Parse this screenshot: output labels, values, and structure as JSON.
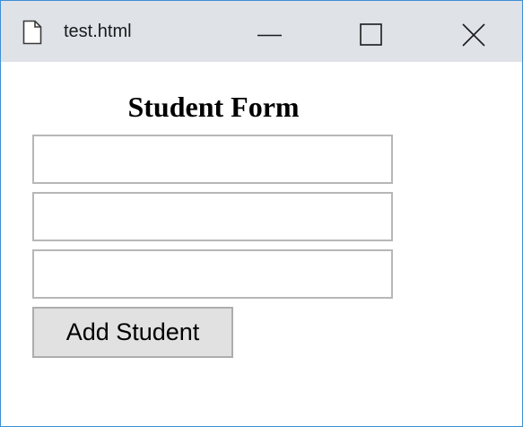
{
  "window": {
    "title": "test.html",
    "controls": {
      "minimize_icon": "minimize-icon",
      "maximize_icon": "maximize-icon",
      "close_icon": "close-icon"
    },
    "accent_border_color": "#3c8fd6",
    "titlebar_color": "#dfe3e8"
  },
  "form": {
    "title": "Student Form",
    "fields": [
      {
        "value": "",
        "placeholder": ""
      },
      {
        "value": "",
        "placeholder": ""
      },
      {
        "value": "",
        "placeholder": ""
      }
    ],
    "submit_label": "Add Student"
  }
}
